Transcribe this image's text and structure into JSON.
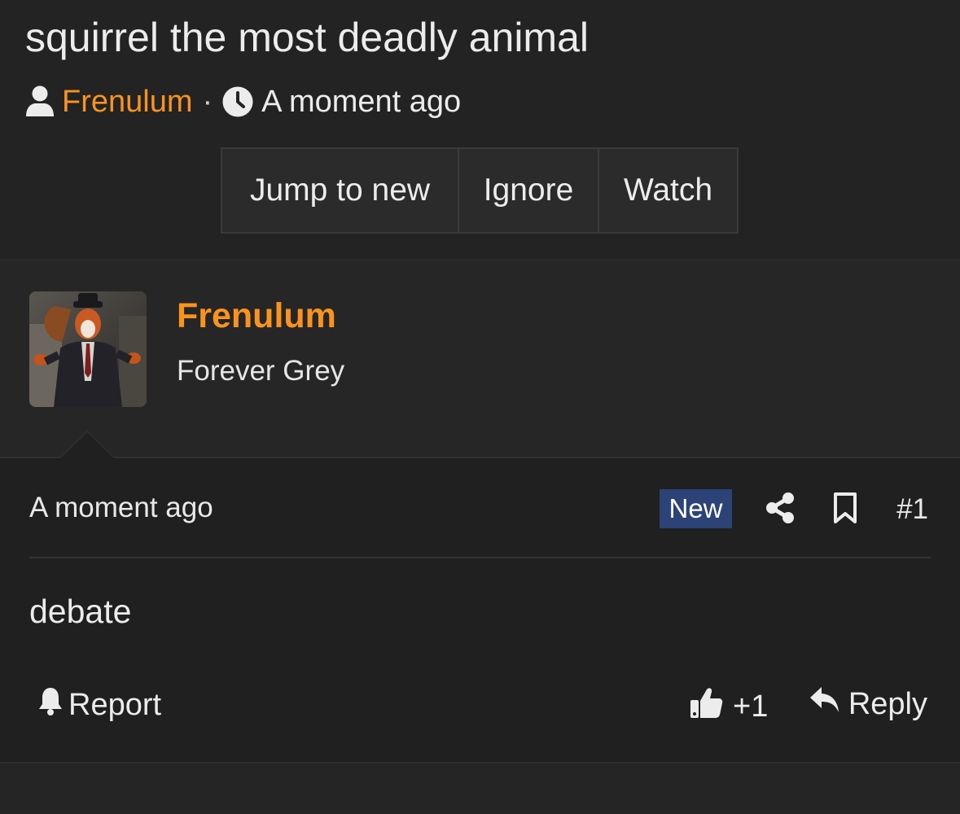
{
  "thread": {
    "title": "squirrel the most deadly animal",
    "author": "Frenulum",
    "separator": "·",
    "time": "A moment ago",
    "buttons": {
      "jump_to_new": "Jump to new",
      "ignore": "Ignore",
      "watch": "Watch"
    }
  },
  "post": {
    "username": "Frenulum",
    "user_title": "Forever Grey",
    "time": "A moment ago",
    "badge": "New",
    "number": "#1",
    "body": "debate",
    "actions": {
      "report": "Report",
      "like": "+1",
      "reply": "Reply"
    }
  },
  "colors": {
    "accent": "#f7931e",
    "badge_bg": "#2b4377",
    "page_bg": "#232323",
    "text": "#ececec"
  },
  "icons": {
    "author": "user-icon",
    "time": "clock-icon",
    "share": "share-icon",
    "bookmark": "bookmark-icon",
    "report": "bell-icon",
    "like": "thumbs-up-icon",
    "reply": "reply-arrow-icon"
  }
}
